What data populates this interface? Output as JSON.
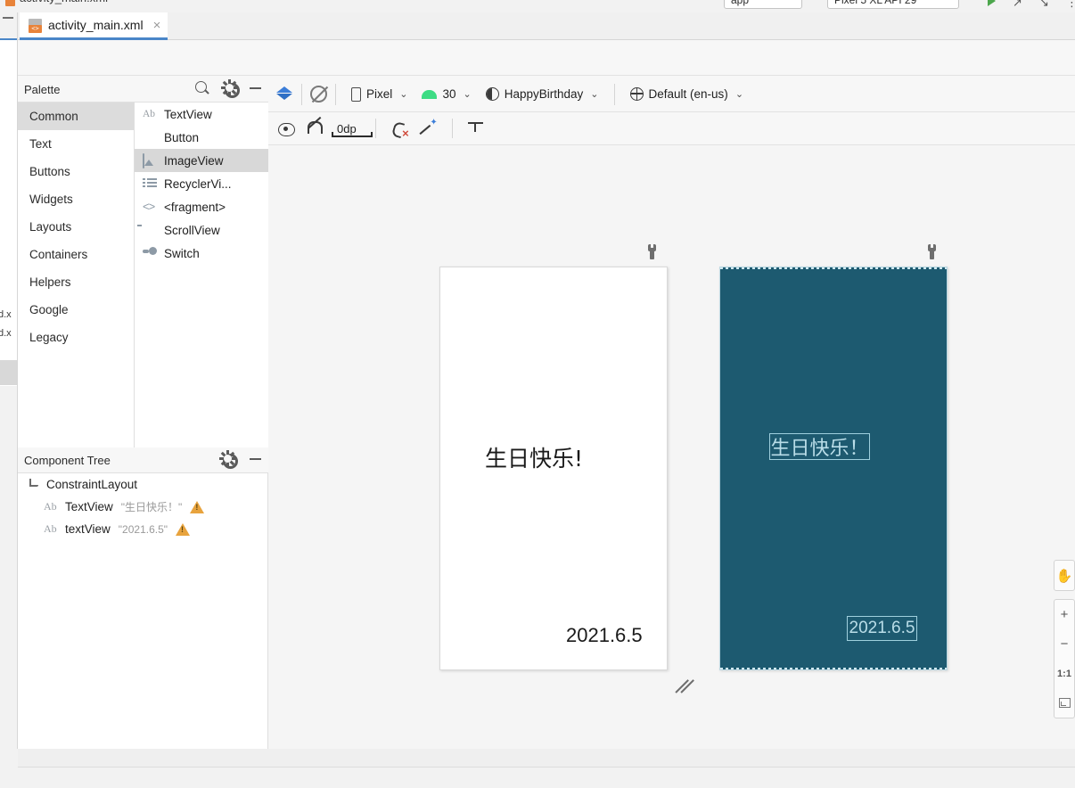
{
  "window": {
    "ghost_tab_title": "activity_main.xml",
    "run_config": "app",
    "device_target": "Pixel 5 XL API 29",
    "misc_icons": [
      "run-icon",
      "debug-icon",
      "profile-icon",
      "more-icon"
    ]
  },
  "editor_tab": {
    "label": "activity_main.xml",
    "close_label": "×",
    "icon": "xml-layout-file-icon"
  },
  "left_strip": {
    "collapse_label": "—",
    "peek_files": [
      "d.x",
      "d.x"
    ]
  },
  "palette": {
    "title": "Palette",
    "icons": [
      "search-icon",
      "gear-icon",
      "minimize-icon"
    ],
    "categories": [
      {
        "label": "Common",
        "selected": true
      },
      {
        "label": "Text",
        "selected": false
      },
      {
        "label": "Buttons",
        "selected": false
      },
      {
        "label": "Widgets",
        "selected": false
      },
      {
        "label": "Layouts",
        "selected": false
      },
      {
        "label": "Containers",
        "selected": false
      },
      {
        "label": "Helpers",
        "selected": false
      },
      {
        "label": "Google",
        "selected": false
      },
      {
        "label": "Legacy",
        "selected": false
      }
    ],
    "widgets": [
      {
        "label": "TextView",
        "icon": "textview-icon",
        "selected": false
      },
      {
        "label": "Button",
        "icon": "button-icon",
        "selected": false
      },
      {
        "label": "ImageView",
        "icon": "imageview-icon",
        "selected": true
      },
      {
        "label": "RecyclerVi...",
        "icon": "recyclerview-icon",
        "selected": false
      },
      {
        "label": "<fragment>",
        "icon": "fragment-icon",
        "selected": false
      },
      {
        "label": "ScrollView",
        "icon": "scrollview-icon",
        "selected": false
      },
      {
        "label": "Switch",
        "icon": "switch-icon",
        "selected": false
      }
    ]
  },
  "component_tree": {
    "title": "Component Tree",
    "icons": [
      "gear-icon",
      "minimize-icon"
    ],
    "nodes": [
      {
        "level": 0,
        "icon": "constraintlayout-icon",
        "label": "ConstraintLayout",
        "value": "",
        "warning": false
      },
      {
        "level": 1,
        "icon": "textview-icon",
        "label": "TextView",
        "value": "\"生日快乐！\"",
        "warning": true
      },
      {
        "level": 1,
        "icon": "textview-icon",
        "label": "textView",
        "value": "\"2021.6.5\"",
        "warning": true
      }
    ]
  },
  "design_toolbar": {
    "view_mode_icon": "design-blueprint-layers-icon",
    "orientation_icon": "rotate-orientation-icon",
    "device": "Pixel",
    "api_level": "30",
    "theme": "HappyBirthday",
    "locale": "Default (en-us)",
    "chevron": "⌄"
  },
  "constraint_toolbar": {
    "show_constraints": "show-constraints-eye-icon",
    "autoconnect": "autoconnect-magnet-icon",
    "default_margin": "0dp",
    "clear_constraints": "clear-all-constraints-icon",
    "infer_constraints": "infer-constraints-magic-icon",
    "baseline_align": "baseline-align-icon"
  },
  "canvas": {
    "design_surface": {
      "title_text": "生日快乐!",
      "date_text": "2021.6.5",
      "wrench_icon": "device-config-wrench-icon"
    },
    "blueprint_surface": {
      "title_text": "生日快乐！",
      "date_text": "2021.6.5",
      "wrench_icon": "device-config-wrench-icon",
      "background_color": "#1d5a70",
      "stroke_color": "#9fd0de"
    },
    "resize_handle": "canvas-resize-handle"
  },
  "zoom_panel": {
    "pan": "✋",
    "zoom_in": "+",
    "zoom_out": "−",
    "actual_size": "1:1",
    "zoom_to_fit": "zoom-to-fit-icon"
  }
}
